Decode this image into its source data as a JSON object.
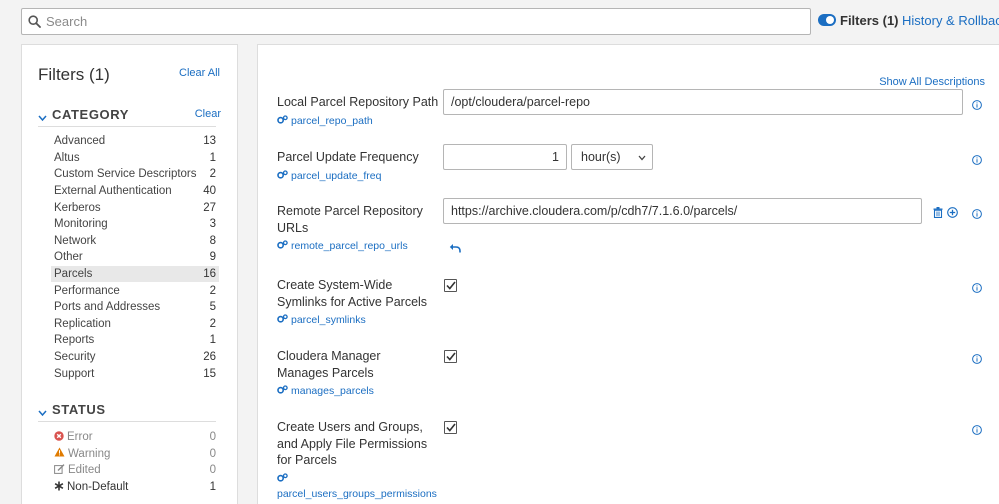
{
  "header": {
    "search_placeholder": "Search",
    "filters_toggle_label": "Filters (1)",
    "history_link": "History & Rollback"
  },
  "sidebar": {
    "title": "Filters (1)",
    "clear_all": "Clear All",
    "category": {
      "title": "CATEGORY",
      "clear": "Clear",
      "items": [
        {
          "label": "Advanced",
          "count": "13"
        },
        {
          "label": "Altus",
          "count": "1"
        },
        {
          "label": "Custom Service Descriptors",
          "count": "2"
        },
        {
          "label": "External Authentication",
          "count": "40"
        },
        {
          "label": "Kerberos",
          "count": "27"
        },
        {
          "label": "Monitoring",
          "count": "3"
        },
        {
          "label": "Network",
          "count": "8"
        },
        {
          "label": "Other",
          "count": "9"
        },
        {
          "label": "Parcels",
          "count": "16"
        },
        {
          "label": "Performance",
          "count": "2"
        },
        {
          "label": "Ports and Addresses",
          "count": "5"
        },
        {
          "label": "Replication",
          "count": "2"
        },
        {
          "label": "Reports",
          "count": "1"
        },
        {
          "label": "Security",
          "count": "26"
        },
        {
          "label": "Support",
          "count": "15"
        }
      ],
      "selected": "Parcels"
    },
    "status": {
      "title": "STATUS",
      "items": [
        {
          "label": "Error",
          "count": "0",
          "icon": "error-circle-icon"
        },
        {
          "label": "Warning",
          "count": "0",
          "icon": "warning-triangle-icon"
        },
        {
          "label": "Edited",
          "count": "0",
          "icon": "edit-icon"
        },
        {
          "label": "Non-Default",
          "count": "1",
          "icon": "asterisk-icon"
        }
      ]
    }
  },
  "main": {
    "show_all_descriptions": "Show All Descriptions",
    "properties": [
      {
        "label": "Local Parcel Repository Path",
        "name": "parcel_repo_path",
        "value": "/opt/cloudera/parcel-repo"
      },
      {
        "label": "Parcel Update Frequency",
        "name": "parcel_update_freq",
        "value": "1",
        "unit": "hour(s)"
      },
      {
        "label": "Remote Parcel Repository URLs",
        "name": "remote_parcel_repo_urls",
        "value": "https://archive.cloudera.com/p/cdh7/7.1.6.0/parcels/"
      },
      {
        "label": "Create System-Wide Symlinks for Active Parcels",
        "name": "parcel_symlinks",
        "checked": true
      },
      {
        "label": "Cloudera Manager Manages Parcels",
        "name": "manages_parcels",
        "checked": true
      },
      {
        "label": "Create Users and Groups, and Apply File Permissions for Parcels",
        "name": "parcel_users_groups_permissions",
        "checked": true
      }
    ]
  },
  "colors": {
    "accent": "#1b6ec2",
    "error": "#d9534f",
    "warning": "#e07b00"
  }
}
